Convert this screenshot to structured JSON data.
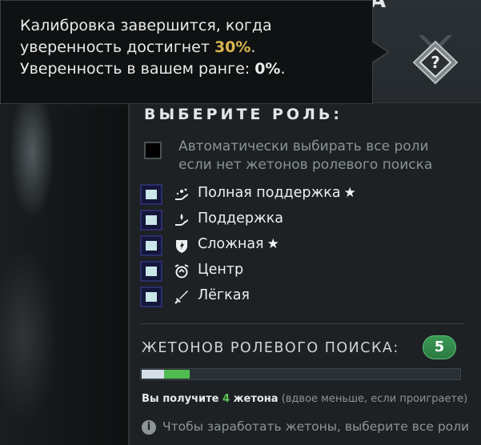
{
  "header": {
    "title_fragment": "А"
  },
  "tooltip": {
    "line1": "Калибровка завершится, когда",
    "line2_prefix": "уверенность достигнет ",
    "line2_value": "30%",
    "line2_suffix": ".",
    "line3_prefix": "Уверенность в вашем ранге: ",
    "line3_value": "0%",
    "line3_suffix": "."
  },
  "rank_emblem": {
    "icon": "unknown-rank-icon",
    "symbol": "?"
  },
  "roles_section": {
    "title": "ВЫБЕРИТЕ РОЛЬ:",
    "auto_select": {
      "line1": "Автоматически выбирать все роли",
      "line2": "если нет жетонов ролевого поиска",
      "checked": false
    },
    "roles": [
      {
        "label": "Полная поддержка",
        "icon": "hard-support-icon",
        "starred": true,
        "star": "★"
      },
      {
        "label": "Поддержка",
        "icon": "support-icon",
        "starred": false
      },
      {
        "label": "Сложная",
        "icon": "offlane-icon",
        "starred": true,
        "star": "★"
      },
      {
        "label": "Центр",
        "icon": "mid-icon",
        "starred": false
      },
      {
        "label": "Лёгкая",
        "icon": "safe-lane-icon",
        "starred": false
      }
    ]
  },
  "tokens": {
    "label": "ЖЕТОНОВ РОЛЕВОГО ПОИСКА:",
    "count": "5",
    "progress": {
      "current_fraction": 0.07,
      "gain_fraction": 0.08
    },
    "earn_prefix": "Вы получите ",
    "earn_count": "4",
    "earn_suffix": " жетона",
    "earn_note": " (вдвое меньше, если проиграете)",
    "hint_icon": "info-icon",
    "hint_symbol": "i",
    "hint": "Чтобы заработать жетоны, выберите все роли"
  },
  "colors": {
    "accent_gold": "#d9b64f",
    "token_green": "#4fbc4f",
    "checkbox_fill": "#c9e6e9"
  }
}
